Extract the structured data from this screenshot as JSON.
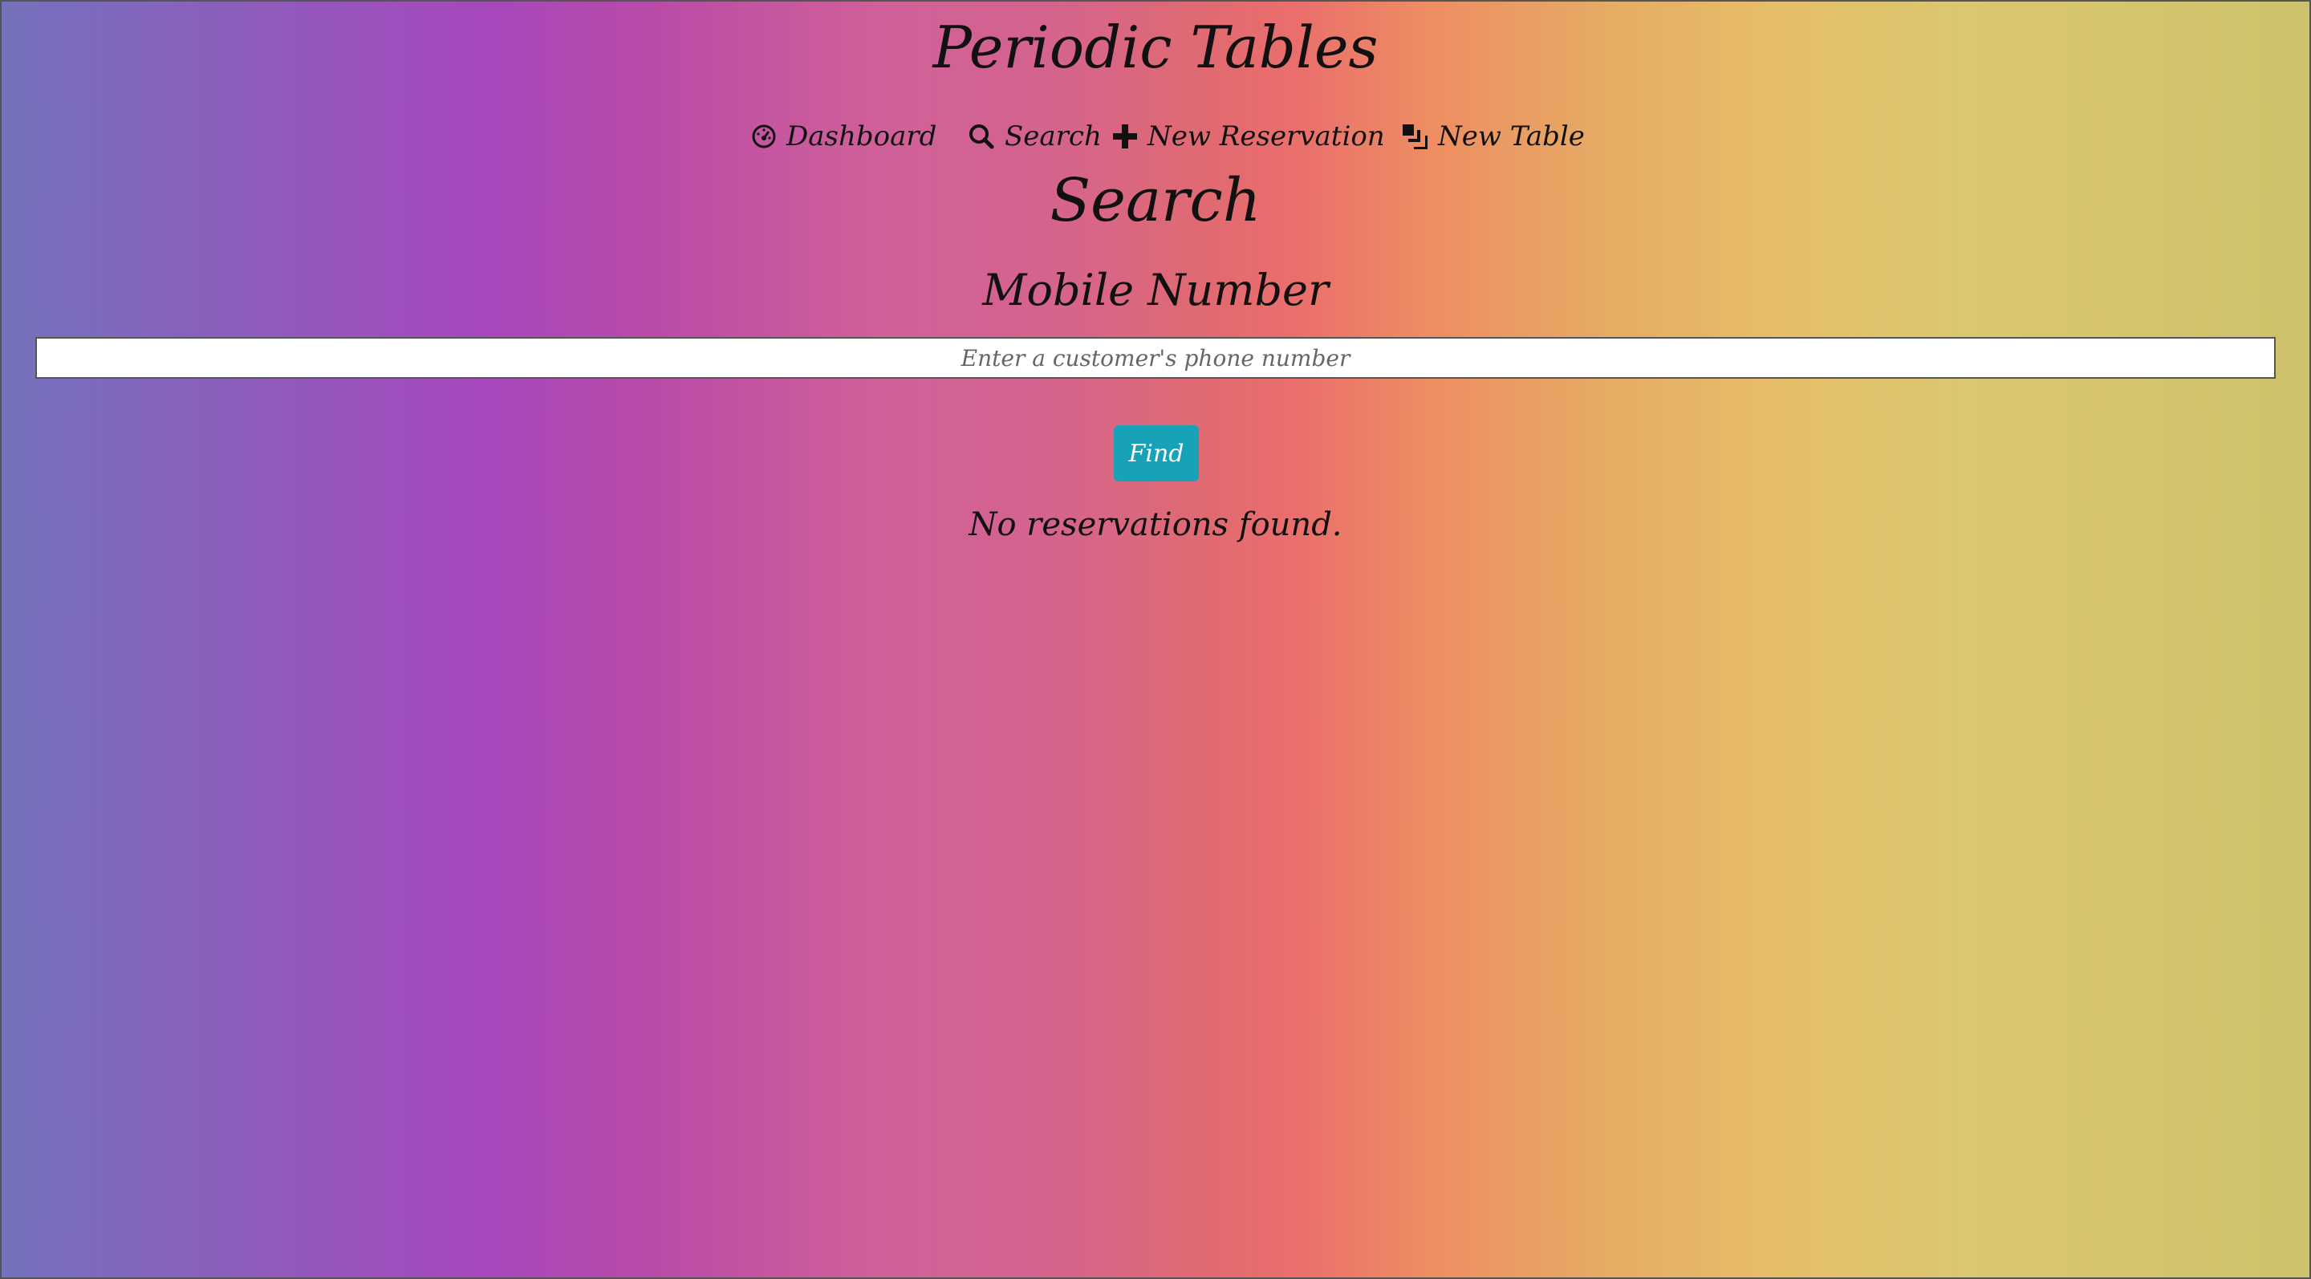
{
  "app": {
    "title": "Periodic Tables"
  },
  "nav": {
    "items": [
      {
        "label": "Dashboard",
        "icon": "dashboard-icon"
      },
      {
        "label": "Search",
        "icon": "search-icon"
      },
      {
        "label": "New Reservation",
        "icon": "plus-icon"
      },
      {
        "label": "New Table",
        "icon": "layers-icon"
      }
    ]
  },
  "page": {
    "heading": "Search",
    "field_label": "Mobile Number",
    "search_placeholder": "Enter a customer's phone number",
    "search_value": "",
    "find_label": "Find",
    "result_message": "No reservations found."
  },
  "colors": {
    "find_button": "#17a2b8",
    "input_background": "#ffffff",
    "text": "#111111"
  }
}
